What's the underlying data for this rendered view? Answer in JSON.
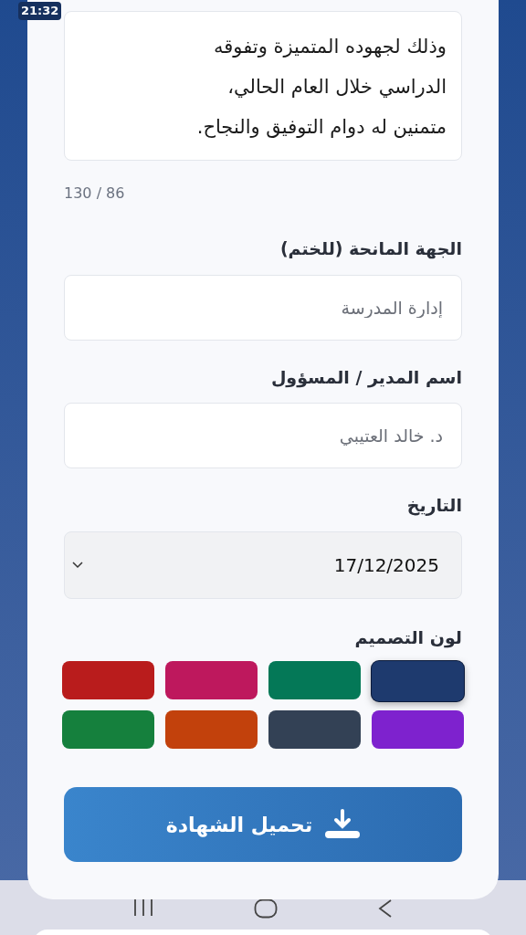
{
  "status_bar": {
    "time": "21:32"
  },
  "message": {
    "value": "وذلك لجهوده المتميزة وتفوقه\nالدراسي خلال العام الحالي،\nمتمنين له دوام التوفيق والنجاح.",
    "counter": "130 / 86"
  },
  "fields": [
    {
      "label": "الجهة المانحة (للختم)",
      "placeholder": "إدارة المدرسة"
    },
    {
      "label": "اسم المدير / المسؤول",
      "placeholder": "د. خالد العتيبي"
    }
  ],
  "date": {
    "label": "التاريخ",
    "value": "17/12/2025"
  },
  "design_color": {
    "label": "لون التصميم",
    "swatches": [
      {
        "color": "#1e3a6e",
        "selected": true
      },
      {
        "color": "#047857",
        "selected": false
      },
      {
        "color": "#be185d",
        "selected": false
      },
      {
        "color": "#b91c1c",
        "selected": false
      },
      {
        "color": "#7e22ce",
        "selected": false
      },
      {
        "color": "#334155",
        "selected": false
      },
      {
        "color": "#c2410c",
        "selected": false
      },
      {
        "color": "#15803d",
        "selected": false
      }
    ]
  },
  "download_button": {
    "label": "تحميل الشهادة"
  }
}
